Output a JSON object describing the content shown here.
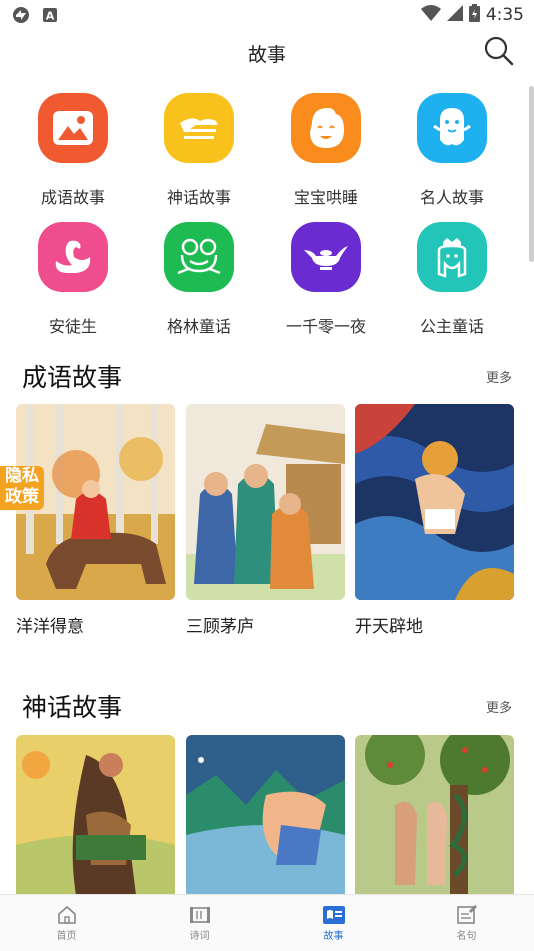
{
  "status_bar": {
    "time": "4:35"
  },
  "header": {
    "title": "故事"
  },
  "categories": [
    {
      "label": "成语故事",
      "color": "#f15a31",
      "icon": "landscape-icon"
    },
    {
      "label": "神话故事",
      "color": "#f8c11c",
      "icon": "cloud-icon"
    },
    {
      "label": "宝宝哄睡",
      "color": "#fa8c1e",
      "icon": "baby-face-icon"
    },
    {
      "label": "名人故事",
      "color": "#1fb0f0",
      "icon": "ghost-icon"
    },
    {
      "label": "安徒生",
      "color": "#ef4d8d",
      "icon": "swan-icon"
    },
    {
      "label": "格林童话",
      "color": "#1dbb52",
      "icon": "frog-icon"
    },
    {
      "label": "一千零一夜",
      "color": "#6a2bd0",
      "icon": "magic-lamp-icon"
    },
    {
      "label": "公主童话",
      "color": "#22c5b7",
      "icon": "princess-icon"
    }
  ],
  "sections": [
    {
      "title": "成语故事",
      "more": "更多",
      "items": [
        "洋洋得意",
        "三顾茅庐",
        "开天辟地"
      ]
    },
    {
      "title": "神话故事",
      "more": "更多"
    }
  ],
  "privacy_badge": "隐私\n政策",
  "privacy_line1": "隐私",
  "privacy_line2": "政策",
  "bottom_nav": [
    {
      "label": "首页",
      "icon": "home-icon"
    },
    {
      "label": "诗词",
      "icon": "scroll-icon"
    },
    {
      "label": "故事",
      "icon": "book-icon",
      "active": true
    },
    {
      "label": "名句",
      "icon": "edit-icon"
    }
  ]
}
